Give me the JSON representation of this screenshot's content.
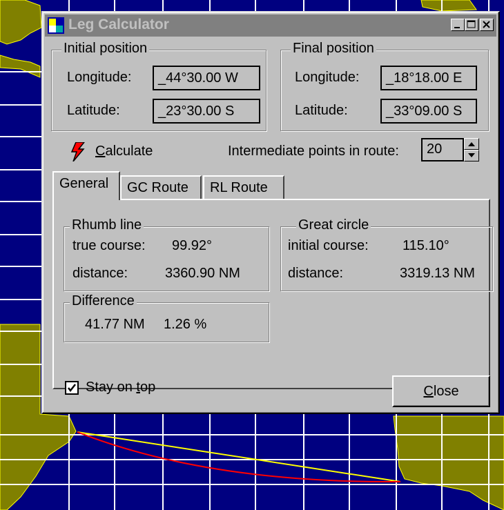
{
  "window": {
    "title": "Leg Calculator",
    "controls": [
      "minimize-icon",
      "maximize-icon",
      "close-icon"
    ]
  },
  "initial_position": {
    "legend": "Initial position",
    "longitude_label": "Longitude:",
    "longitude_value": "_44°30.00 W",
    "latitude_label": "Latitude:",
    "latitude_value": "_23°30.00 S"
  },
  "final_position": {
    "legend": "Final position",
    "longitude_label": "Longitude:",
    "longitude_value": "_18°18.00 E",
    "latitude_label": "Latitude:",
    "latitude_value": "_33°09.00 S"
  },
  "calculate": {
    "mnemonic": "C",
    "label_rest": "alculate",
    "icon": "lightning-icon"
  },
  "intermediate": {
    "label": "Intermediate points in route:",
    "value": "20"
  },
  "tabs": [
    "General",
    "GC Route",
    "RL Route"
  ],
  "rhumb_line": {
    "legend": "Rhumb line",
    "course_label": "true course:",
    "course_value": "99.92°",
    "distance_label": "distance:",
    "distance_value": "3360.90 NM"
  },
  "great_circle": {
    "legend": "Great circle",
    "course_label": "initial course:",
    "course_value": "115.10°",
    "distance_label": "distance:",
    "distance_value": "3319.13 NM"
  },
  "difference": {
    "legend": "Difference",
    "nm_value": "41.77 NM",
    "percent_value": "1.26 %"
  },
  "stay_on_top": {
    "checked": true,
    "label_before": "Stay on ",
    "mnemonic": "t",
    "label_after": "op"
  },
  "close_button": {
    "mnemonic": "C",
    "label_rest": "lose"
  },
  "colors": {
    "ocean": "#000080",
    "land": "#808000",
    "grid": "#ffffff",
    "rhumb_route": "#ffff00",
    "gc_route": "#ff0000",
    "titlebar_inactive": "#808080"
  }
}
